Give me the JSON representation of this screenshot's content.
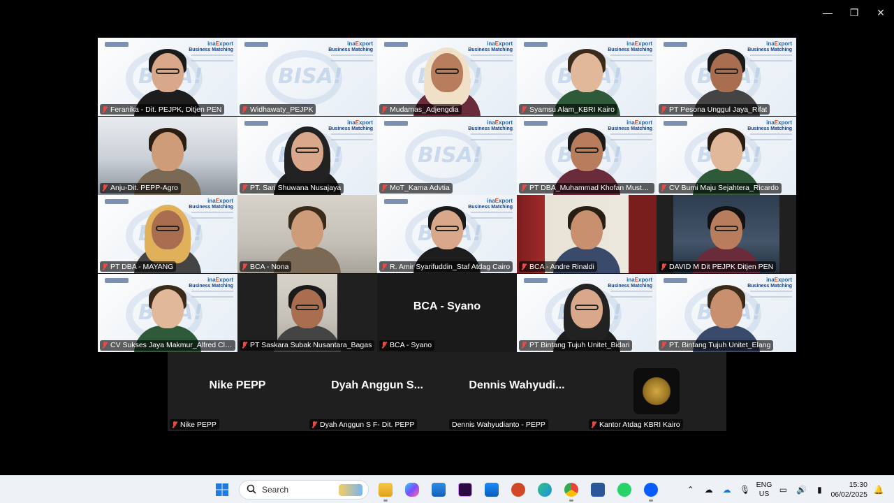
{
  "window": {
    "controls": [
      "minimize",
      "maximize",
      "close"
    ]
  },
  "participants": [
    {
      "name": "Feranika - Dit. PEJPK, Ditjen PEN",
      "type": "slide-person",
      "active": true
    },
    {
      "name": "Widhawaty_PEJPK",
      "type": "slide"
    },
    {
      "name": "Mudamas_Adjengdia",
      "type": "slide-person"
    },
    {
      "name": "Syamsu Alam_KBRI Kairo",
      "type": "slide-person"
    },
    {
      "name": "PT Pesona Unggul Jaya_Rifat",
      "type": "slide-person"
    },
    {
      "name": "Anju-Dit. PEPP-Agro",
      "type": "office"
    },
    {
      "name": "PT. Sari Shuwana Nusajaya",
      "type": "slide-person"
    },
    {
      "name": "MoT_Kama Advtia",
      "type": "slide"
    },
    {
      "name": "PT DBA_Muhammad Khofan Mustak...",
      "type": "slide-person"
    },
    {
      "name": "CV Bumi Maju Sejahtera_Ricardo",
      "type": "slide-person"
    },
    {
      "name": "PT DBA - MAYANG",
      "type": "slide-person"
    },
    {
      "name": "BCA - Nona",
      "type": "office"
    },
    {
      "name": "R. Amir Syarifuddin_Staf Atdag Cairo",
      "type": "slide-person"
    },
    {
      "name": "BCA - Andre Rinaldi",
      "type": "office"
    },
    {
      "name": "DAVID M Dit PEJPK Ditjen PEN",
      "type": "office"
    },
    {
      "name": "CV Sukses Jaya Makmur_Alfred Clem...",
      "type": "slide-person"
    },
    {
      "name": "PT Saskara Subak Nusantara_Bagas",
      "type": "office"
    },
    {
      "name": "BCA - Syano",
      "type": "name-only",
      "display": "BCA - Syano"
    },
    {
      "name": "PT Bintang Tujuh Unitet_Bidari",
      "type": "slide-person"
    },
    {
      "name": "PT. Bintang Tujuh Unitet_Elang",
      "type": "slide-person"
    }
  ],
  "participants_row2": [
    {
      "name": "Nike PEPP",
      "display": "Nike PEPP",
      "muted": true
    },
    {
      "name": "Dyah Anggun S F- Dit. PEPP",
      "display": "Dyah Anggun S...",
      "muted": true
    },
    {
      "name": "Dennis Wahyudianto - PEPP",
      "display": "Dennis Wahyudi...",
      "muted": false
    },
    {
      "name": "Kantor Atdag KBRI Kairo",
      "display": "",
      "muted": true,
      "emblem": true
    }
  ],
  "slide": {
    "brand_left": "inaExport",
    "title": "Business Matching",
    "watermark": "BISA!"
  },
  "taskbar": {
    "search_placeholder": "Search",
    "apps": [
      "windows-start",
      "file-explorer",
      "copilot",
      "microsoft-store",
      "premiere",
      "outlook",
      "powerpoint",
      "edge",
      "chrome",
      "word",
      "whatsapp",
      "zoom"
    ],
    "lang_top": "ENG",
    "lang_bottom": "US",
    "time": "15:30",
    "date": "06/02/2025"
  },
  "colors": {
    "active_speaker": "#23d36b",
    "muted_mic": "#e84a4a",
    "background": "#000000"
  }
}
